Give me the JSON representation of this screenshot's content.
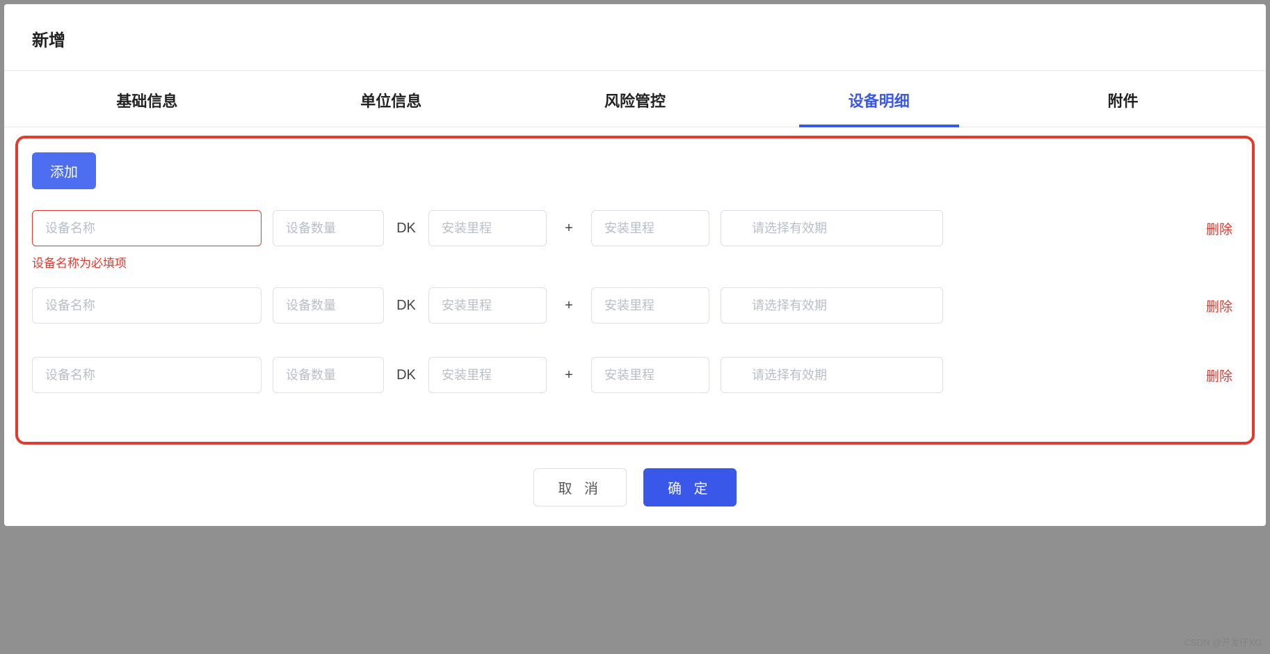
{
  "header": {
    "title": "新增"
  },
  "tabs": {
    "items": [
      {
        "label": "基础信息"
      },
      {
        "label": "单位信息"
      },
      {
        "label": "风险管控"
      },
      {
        "label": "设备明细"
      },
      {
        "label": "附件"
      }
    ],
    "activeIndex": 3
  },
  "form": {
    "add_label": "添加",
    "sep_dk": "DK",
    "sep_plus": "+",
    "delete_label": "删除",
    "placeholders": {
      "name": "设备名称",
      "qty": "设备数量",
      "mile": "安装里程",
      "date": "请选择有效期"
    },
    "rows": [
      {
        "name": "",
        "qty": "",
        "mile1": "",
        "mile2": "",
        "date": "",
        "error": "设备名称为必填项"
      },
      {
        "name": "",
        "qty": "",
        "mile1": "",
        "mile2": "",
        "date": ""
      },
      {
        "name": "",
        "qty": "",
        "mile1": "",
        "mile2": "",
        "date": ""
      }
    ]
  },
  "footer": {
    "cancel_label": "取 消",
    "confirm_label": "确 定"
  },
  "watermark": "CSDN @开发仔XG"
}
